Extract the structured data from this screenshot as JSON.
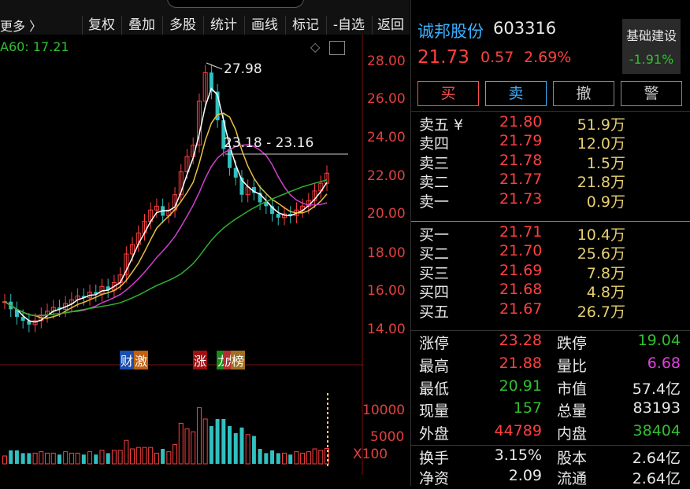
{
  "toolbar": {
    "more_label": "更多 〉",
    "buttons": [
      "复权",
      "叠加",
      "多股",
      "统计",
      "画线",
      "标记",
      "-自选",
      "返回"
    ]
  },
  "chart": {
    "ma_label": "A60: 17.21",
    "high_label": "27.98",
    "range_label": "23.18 - 23.16",
    "y_ticks": [
      "28.00",
      "26.00",
      "24.00",
      "22.00",
      "20.00",
      "18.00",
      "16.00",
      "14.00"
    ],
    "vol_ticks": [
      "10000",
      "5000",
      "X100"
    ],
    "event_tags": [
      "财",
      "激",
      "涨",
      "龙",
      "虎",
      "榜"
    ]
  },
  "stock": {
    "name": "诚邦股份",
    "code": "603316",
    "price": "21.73",
    "change": "0.57",
    "change_pct": "2.69%",
    "basic_label": "基础建设",
    "basic_val": "-1.91%"
  },
  "actions": [
    "买",
    "卖",
    "撤",
    "警"
  ],
  "orderbook": {
    "asks": [
      {
        "label": "卖五 ¥",
        "price": "21.80",
        "vol": "51.9万"
      },
      {
        "label": "卖四",
        "price": "21.79",
        "vol": "12.0万"
      },
      {
        "label": "卖三",
        "price": "21.78",
        "vol": "1.5万"
      },
      {
        "label": "卖二",
        "price": "21.77",
        "vol": "21.8万"
      },
      {
        "label": "卖一",
        "price": "21.73",
        "vol": "0.9万"
      }
    ],
    "bids": [
      {
        "label": "买一",
        "price": "21.71",
        "vol": "10.4万"
      },
      {
        "label": "买二",
        "price": "21.70",
        "vol": "25.6万"
      },
      {
        "label": "买三",
        "price": "21.69",
        "vol": "7.8万"
      },
      {
        "label": "买四",
        "price": "21.68",
        "vol": "4.8万"
      },
      {
        "label": "买五",
        "price": "21.67",
        "vol": "26.7万"
      }
    ]
  },
  "stats": [
    {
      "l1": "涨停",
      "v1": "23.28",
      "c1": "red",
      "l2": "跌停",
      "v2": "19.04",
      "c2": "green"
    },
    {
      "l1": "最高",
      "v1": "21.88",
      "c1": "red",
      "l2": "量比",
      "v2": "6.68",
      "c2": "magenta"
    },
    {
      "l1": "最低",
      "v1": "20.91",
      "c1": "green",
      "l2": "市值",
      "v2": "57.4亿",
      "c2": "white"
    },
    {
      "l1": "现量",
      "v1": "157",
      "c1": "green",
      "l2": "总量",
      "v2": "83193",
      "c2": "white"
    },
    {
      "l1": "外盘",
      "v1": "44789",
      "c1": "red",
      "l2": "内盘",
      "v2": "38404",
      "c2": "green"
    },
    {
      "l1": "换手",
      "v1": "3.15%",
      "c1": "white",
      "l2": "股本",
      "v2": "2.64亿",
      "c2": "white"
    },
    {
      "l1": "净资",
      "v1": "2.09",
      "c1": "white",
      "l2": "流通",
      "v2": "2.64亿",
      "c2": "white"
    }
  ],
  "colors": {
    "up": "#ff4040",
    "down": "#30c0c0",
    "ma5": "#ffffff",
    "ma10": "#e8c040",
    "ma20": "#d040d0",
    "ma60": "#30b030"
  }
}
